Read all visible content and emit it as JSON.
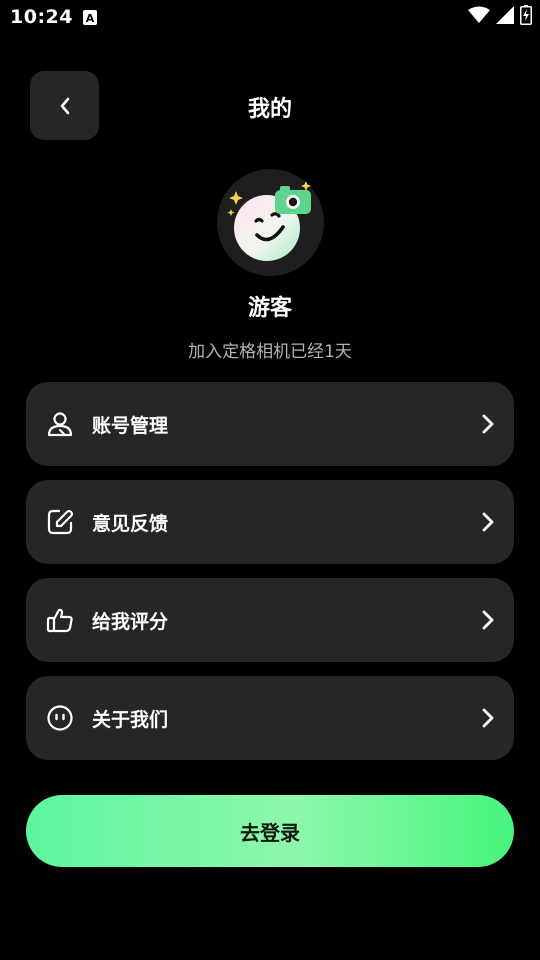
{
  "status_bar": {
    "time": "10:24",
    "notification_icon": "a-badge-icon",
    "wifi_icon": "wifi-icon",
    "signal_icon": "cell-signal-icon",
    "battery_icon": "battery-charging-icon"
  },
  "header": {
    "back_icon": "chevron-left-icon",
    "title": "我的"
  },
  "profile": {
    "avatar_icon": "smiley-camera-avatar-icon",
    "username": "游客",
    "join_text": "加入定格相机已经1天"
  },
  "menu": {
    "items": [
      {
        "label": "账号管理",
        "icon": "user-account-icon"
      },
      {
        "label": "意见反馈",
        "icon": "feedback-edit-icon"
      },
      {
        "label": "给我评分",
        "icon": "thumbs-up-icon"
      },
      {
        "label": "关于我们",
        "icon": "about-face-icon"
      }
    ]
  },
  "login": {
    "label": "去登录"
  },
  "colors": {
    "background": "#000000",
    "card": "#262626",
    "accent_green": "#5cf69c",
    "subtext": "#b3b3b3"
  }
}
